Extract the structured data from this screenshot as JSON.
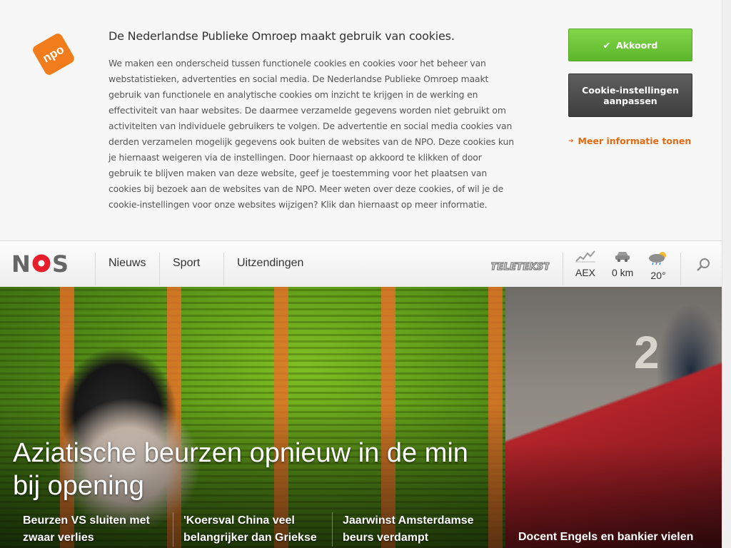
{
  "cookie": {
    "title": "De Nederlandse Publieke Omroep maakt gebruik van cookies.",
    "text": "We maken een onderscheid tussen functionele cookies en cookies voor het beheer van webstatistieken, advertenties en social media. De Nederlandse Publieke Omroep maakt gebruik van functionele en analytische cookies om inzicht te krijgen in de werking en effectiviteit van haar websites. De daarmee verzamelde gegevens worden niet gebruikt om activiteiten van individuele gebruikers te volgen. De advertentie en social media cookies van derden verzamelen mogelijk gegevens ook buiten de websites van de NPO. Deze cookies kun je hiernaast weigeren via de instellingen. Door hiernaast op akkoord te klikken of door gebruik te blijven maken van deze website, geef je toestemming voor het plaatsen van cookies bij bezoek aan de websites van de NPO. Meer weten over deze cookies, of wil je de cookie-instellingen voor onze websites wijzigen? Klik dan hiernaast op meer informatie.",
    "accept_label": "Akkoord",
    "settings_label": "Cookie-instellingen aanpassen",
    "more_info_label": "Meer informatie tonen",
    "logo_text": "npo",
    "logo_color": "#f07c1b",
    "accept_color": "#6cc53a",
    "link_color": "#e56a13"
  },
  "header": {
    "logo_text": "NOS",
    "nav": [
      "Nieuws",
      "Sport",
      "Uitzendingen"
    ],
    "teletekst_label": "TELETEKST",
    "widgets": [
      {
        "icon": "chart-icon",
        "label": "AEX"
      },
      {
        "icon": "car-icon",
        "label": "0 km"
      },
      {
        "icon": "weather-icon",
        "label": "20°"
      }
    ]
  },
  "hero": {
    "title": "Aziatische beurzen opnieuw in de min bij opening",
    "related": [
      "Beurzen VS sluiten met zwaar verlies",
      "'Koersval China veel belangrijker dan Griekse",
      "Jaarwinst Amsterdamse beurs verdampt"
    ]
  },
  "side": {
    "title": "Docent Engels en bankier vielen"
  }
}
